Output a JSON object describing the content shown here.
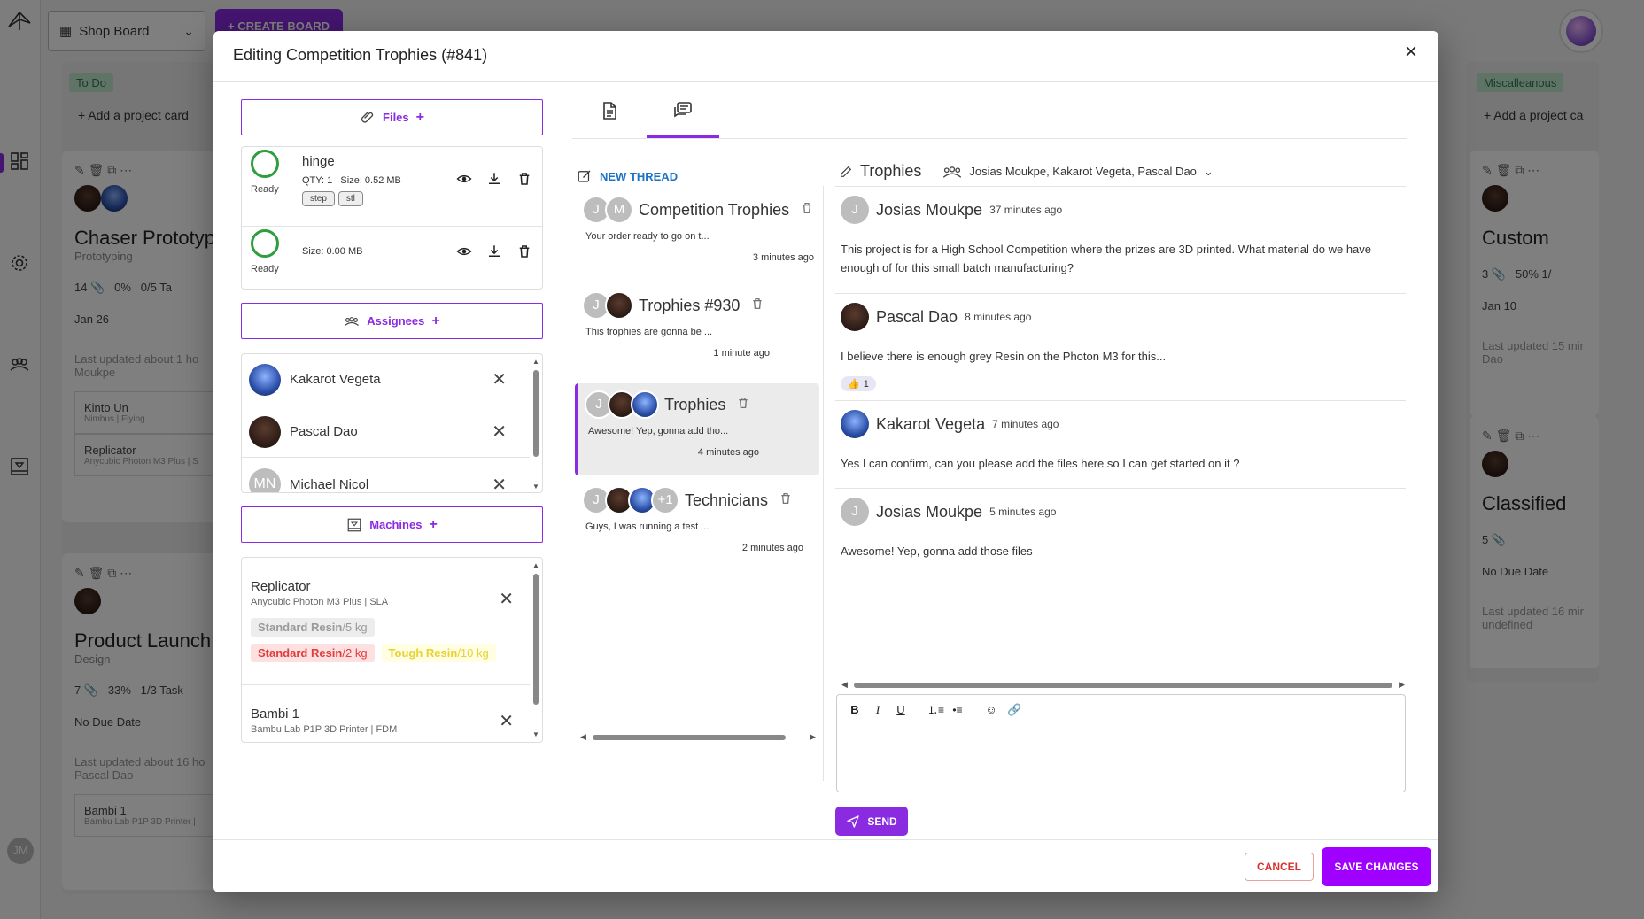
{
  "app": {
    "board_select": "Shop Board",
    "create_board": "CREATE BOARD",
    "rail_user_initials": "JM"
  },
  "background": {
    "col1": {
      "tag": "To Do",
      "add_card": "Add a project card",
      "card1": {
        "title": "Chaser Prototype",
        "subtitle": "Prototyping",
        "count": "14",
        "progress": "0%",
        "tasks": "0/5 Ta",
        "date": "Jan 26",
        "updated": "Last updated about 1 ho",
        "updated2": "Moukpe",
        "sub_items": [
          {
            "title": "Kinto Un",
            "sub": "Nimbus | Flying"
          },
          {
            "title": "Replicator",
            "sub": "Anycubic Photon M3 Plus | S"
          }
        ]
      },
      "card2": {
        "title": "Product Launch",
        "subtitle": "Design",
        "count": "7",
        "progress": "33%",
        "tasks": "1/3 Task",
        "date": "No Due Date",
        "updated": "Last updated about 16 ho",
        "updated2": "Pascal Dao",
        "sub_items": [
          {
            "title": "Bambi 1",
            "sub": "Bambu Lab P1P 3D Printer |"
          }
        ]
      }
    },
    "col2": {
      "tag": "Miscalleanous",
      "add_card": "Add a project ca",
      "card1": {
        "title": "Custom",
        "count": "3",
        "progress": "50%",
        "tasks": "1/",
        "date": "Jan 10",
        "updated": "Last updated 15 mir",
        "updated2": "Dao"
      },
      "card2": {
        "title": "Classified",
        "count": "5",
        "date": "No Due Date",
        "updated": "Last updated 16 mir",
        "updated2": "undefined"
      }
    }
  },
  "modal": {
    "title": "Editing Competition Trophies (#841)",
    "files_label": "Files",
    "assignees_label": "Assignees",
    "machines_label": "Machines",
    "files": [
      {
        "name": "hinge",
        "qty": "QTY: 1",
        "size": "Size: 0.52 MB",
        "status": "Ready",
        "tags": [
          "step",
          "stl"
        ]
      },
      {
        "name": "",
        "qty": "",
        "size": "Size: 0.00 MB",
        "status": "Ready",
        "tags": []
      }
    ],
    "assignees": [
      {
        "name": "Kakarot Vegeta"
      },
      {
        "name": "Pascal Dao"
      },
      {
        "name": "Michael Nicol",
        "initials": "MN"
      }
    ],
    "machines": [
      {
        "name": "Replicator",
        "model": "Anycubic Photon M3 Plus | SLA",
        "resins": [
          {
            "name": "Standard Resin",
            "amount": "/5 kg"
          },
          {
            "name": "Standard Resin",
            "amount": "/2 kg"
          },
          {
            "name": "Tough Resin",
            "amount": "/10 kg"
          }
        ]
      },
      {
        "name": "Bambi 1",
        "model": "Bambu Lab P1P 3D Printer | FDM"
      }
    ],
    "new_thread": "NEW THREAD",
    "threads": [
      {
        "title": "Competition Trophies",
        "preview": "Your order ready to go on t...",
        "time": "3 minutes ago"
      },
      {
        "title": "Trophies #930",
        "preview": "This trophies are gonna be ...",
        "time": "1 minute ago"
      },
      {
        "title": "Trophies",
        "preview": "Awesome! Yep, gonna add tho...",
        "time": "4 minutes ago"
      },
      {
        "title": "Technicians",
        "preview": "Guys, I was running a test ...",
        "time": "2 minutes ago",
        "extra": "+1"
      }
    ],
    "conversation": {
      "title": "Trophies",
      "participants": "Josias Moukpe, Kakarot Vegeta, Pascal Dao",
      "messages": [
        {
          "author": "Josias Moukpe",
          "time": "37 minutes ago",
          "body": "This project is for a High School Competition where the prizes are 3D printed. What material do we have enough of for this small batch manufacturing?"
        },
        {
          "author": "Pascal Dao",
          "time": "8 minutes ago",
          "body": "I believe there is enough grey Resin on the Photon M3 for this...",
          "reaction": "👍",
          "reaction_count": "1"
        },
        {
          "author": "Kakarot Vegeta",
          "time": "7 minutes ago",
          "body": "Yes I can confirm, can you please add the files here so I can get started on it ?"
        },
        {
          "author": "Josias Moukpe",
          "time": "5 minutes ago",
          "body": "Awesome! Yep, gonna add those files"
        }
      ]
    },
    "send_label": "SEND",
    "cancel_label": "CANCEL",
    "save_label": "SAVE CHANGES"
  }
}
